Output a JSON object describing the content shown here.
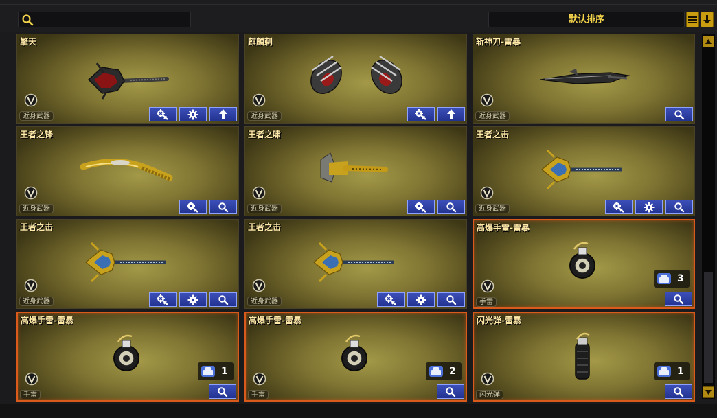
{
  "search": {
    "value": "",
    "placeholder": ""
  },
  "sort": {
    "label": "默认排序"
  },
  "colors": {
    "accent": "#f2d24a",
    "button_blue": "#2a3aa0",
    "highlight_border": "#d95a1a"
  },
  "items": [
    {
      "name": "擎天",
      "category": "近身武器",
      "border": "normal",
      "weapon": "spiked-mace",
      "buttons": [
        "upgrade-icon",
        "settings-icon",
        "arrow-up-icon"
      ]
    },
    {
      "name": "麒麟刺",
      "category": "近身武器",
      "border": "normal",
      "weapon": "dual-claws",
      "buttons": [
        "upgrade-icon",
        "arrow-up-icon"
      ]
    },
    {
      "name": "斩神刀-雷暴",
      "category": "近身武器",
      "border": "normal",
      "weapon": "long-blade",
      "buttons": [
        "search-icon"
      ]
    },
    {
      "name": "王者之锋",
      "category": "近身武器",
      "border": "normal",
      "weapon": "curved-sword",
      "buttons": [
        "upgrade-icon",
        "search-icon"
      ]
    },
    {
      "name": "王者之啸",
      "category": "近身武器",
      "border": "normal",
      "weapon": "golden-axe",
      "buttons": [
        "upgrade-icon",
        "search-icon"
      ]
    },
    {
      "name": "王者之击",
      "category": "近身武器",
      "border": "normal",
      "weapon": "golden-mace",
      "buttons": [
        "upgrade-icon",
        "settings-icon",
        "search-icon"
      ]
    },
    {
      "name": "王者之击",
      "category": "近身武器",
      "border": "normal",
      "weapon": "golden-mace",
      "buttons": [
        "upgrade-icon",
        "settings-icon",
        "search-icon"
      ]
    },
    {
      "name": "王者之击",
      "category": "近身武器",
      "border": "normal",
      "weapon": "golden-mace",
      "buttons": [
        "upgrade-icon",
        "settings-icon",
        "search-icon"
      ]
    },
    {
      "name": "高爆手雷-雷暴",
      "category": "手雷",
      "border": "orange",
      "weapon": "grenade",
      "count": "3",
      "buttons": [
        "search-icon"
      ]
    },
    {
      "name": "高爆手雷-雷暴",
      "category": "手雷",
      "border": "orange",
      "weapon": "grenade",
      "count": "1",
      "buttons": [
        "search-icon"
      ]
    },
    {
      "name": "高爆手雷-雷暴",
      "category": "手雷",
      "border": "orange",
      "weapon": "grenade",
      "count": "2",
      "buttons": [
        "search-icon"
      ]
    },
    {
      "name": "闪光弹-雷暴",
      "category": "闪光弹",
      "border": "orange",
      "weapon": "flashbang",
      "count": "1",
      "buttons": [
        "search-icon"
      ]
    }
  ]
}
